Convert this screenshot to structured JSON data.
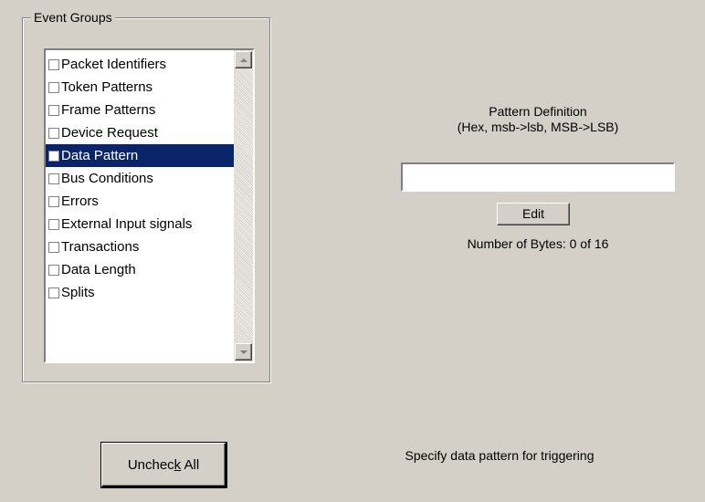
{
  "event_groups": {
    "title": "Event Groups",
    "items": [
      {
        "label": "Packet Identifiers",
        "checked": false,
        "selected": false
      },
      {
        "label": "Token Patterns",
        "checked": false,
        "selected": false
      },
      {
        "label": "Frame Patterns",
        "checked": false,
        "selected": false
      },
      {
        "label": "Device Request",
        "checked": false,
        "selected": false
      },
      {
        "label": "Data Pattern",
        "checked": false,
        "selected": true
      },
      {
        "label": "Bus Conditions",
        "checked": false,
        "selected": false
      },
      {
        "label": "Errors",
        "checked": false,
        "selected": false
      },
      {
        "label": "External Input signals",
        "checked": false,
        "selected": false
      },
      {
        "label": "Transactions",
        "checked": false,
        "selected": false
      },
      {
        "label": "Data Length",
        "checked": false,
        "selected": false
      },
      {
        "label": "Splits",
        "checked": false,
        "selected": false
      }
    ]
  },
  "pattern": {
    "title_line1": "Pattern Definition",
    "title_line2": "(Hex, msb->lsb, MSB->LSB)",
    "value": "",
    "edit_label": "Edit",
    "bytes_count": "Number of Bytes: 0 of 16"
  },
  "uncheck_all": {
    "label_before": "Unchec",
    "label_mnemonic": "k",
    "label_after": " All"
  },
  "hint": "Specify data pattern for triggering",
  "colors": {
    "dialog_bg": "#d4d0c8",
    "selection_bg": "#0a246a",
    "selection_fg": "#ffffff"
  }
}
